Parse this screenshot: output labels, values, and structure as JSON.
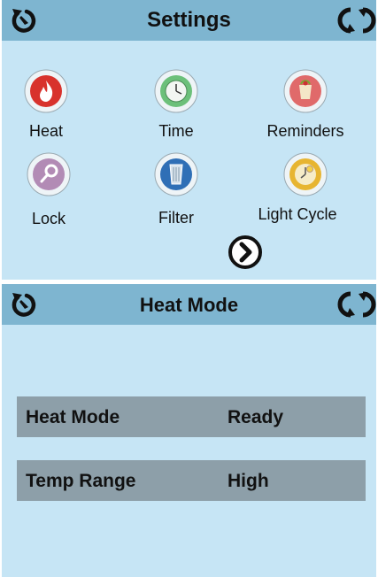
{
  "settings_screen": {
    "title": "Settings",
    "tiles": [
      {
        "label": "Heat",
        "icon": "flame-icon"
      },
      {
        "label": "Time",
        "icon": "clock-icon"
      },
      {
        "label": "Reminders",
        "icon": "reminder-icon"
      },
      {
        "label": "Lock",
        "icon": "lock-key-icon"
      },
      {
        "label": "Filter",
        "icon": "filter-icon"
      },
      {
        "label": "Light Cycle",
        "icon": "light-cycle-icon"
      }
    ],
    "next_icon": "chevron-right-circle-icon"
  },
  "heat_mode_screen": {
    "title": "Heat Mode",
    "rows": [
      {
        "label": "Heat Mode",
        "value": "Ready"
      },
      {
        "label": "Temp Range",
        "value": "High"
      }
    ]
  },
  "colors": {
    "screen_bg": "#c6e5f5",
    "header_bg": "#7eb5d0",
    "row_bg": "#8d9fa9",
    "text": "#111111"
  }
}
